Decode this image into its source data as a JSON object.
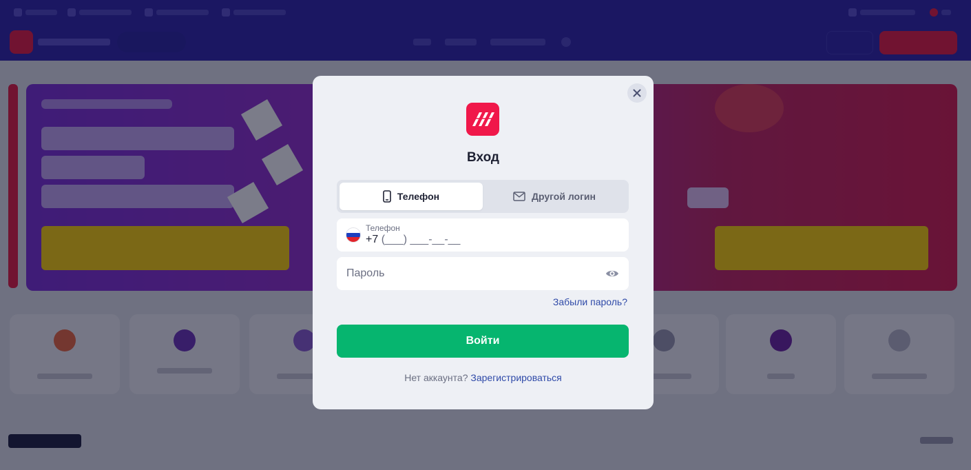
{
  "colors": {
    "brand": "#f0184a",
    "accent_green": "#06b56f",
    "link": "#2f4aa8",
    "backdrop": "#1f1b8f"
  },
  "modal": {
    "title": "Вход",
    "close_icon": "close-icon",
    "logo_icon": "brand-logo-icon",
    "tabs": [
      {
        "label": "Телефон",
        "icon": "phone-icon",
        "active": true
      },
      {
        "label": "Другой логин",
        "icon": "envelope-icon",
        "active": false
      }
    ],
    "phone": {
      "label": "Телефон",
      "prefix": "+7",
      "mask": "(___) ___-__-__",
      "flag_icon": "russia-flag-icon"
    },
    "password": {
      "placeholder": "Пароль",
      "toggle_icon": "eye-icon"
    },
    "forgot_label": "Забыли пароль?",
    "submit_label": "Войти",
    "footer": {
      "text": "Нет аккаунта?",
      "register_label": "Зарегистрироваться"
    }
  }
}
